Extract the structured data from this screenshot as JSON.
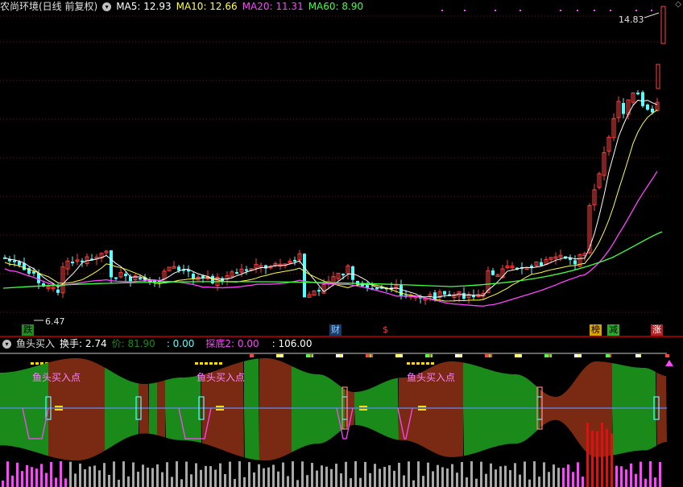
{
  "header": {
    "title": "农尚环境(日线 前复权)",
    "ma5": "MA5: 12.93",
    "ma10": "MA10: 12.66",
    "ma20": "MA20: 11.31",
    "ma60": "MA60: 8.90"
  },
  "price_labels": {
    "high": "14.83",
    "low": "6.47"
  },
  "event_tags": [
    {
      "label": "跌",
      "color": "#000000",
      "bg": "#1f8f1f"
    },
    {
      "label": "财",
      "color": "#8fd0ff",
      "bg": "#1a3a6a"
    },
    {
      "label": "$",
      "color": "#ff3b3b",
      "bg": "none"
    },
    {
      "label": "榜",
      "color": "#000000",
      "bg": "#d9a400"
    },
    {
      "label": "减",
      "color": "#000000",
      "bg": "#2faa2f"
    },
    {
      "label": "涨",
      "color": "#ffffff",
      "bg": "#b52020"
    }
  ],
  "indicator_header": {
    "name": "鱼头买入",
    "turnover": "换手: 2.74",
    "jia": "价: 81.90",
    "blank": ": 0.00",
    "tandi": "探底2: 0.00",
    "vol": ": 106.00"
  },
  "buy_labels": [
    "鱼头买入点",
    "鱼头买入点",
    "鱼头买入点"
  ],
  "colors": {
    "background": "#000000",
    "up": "#ff4040",
    "down": "#54ffff",
    "ma5": "#ffffff",
    "ma10": "#ffff44",
    "ma20": "#ff44ff",
    "ma60": "#44ff44",
    "divider": "#c00000",
    "band_green": "#1a8a1a",
    "band_brown": "#7a2a12",
    "buy_label": "#ff80ff"
  }
}
